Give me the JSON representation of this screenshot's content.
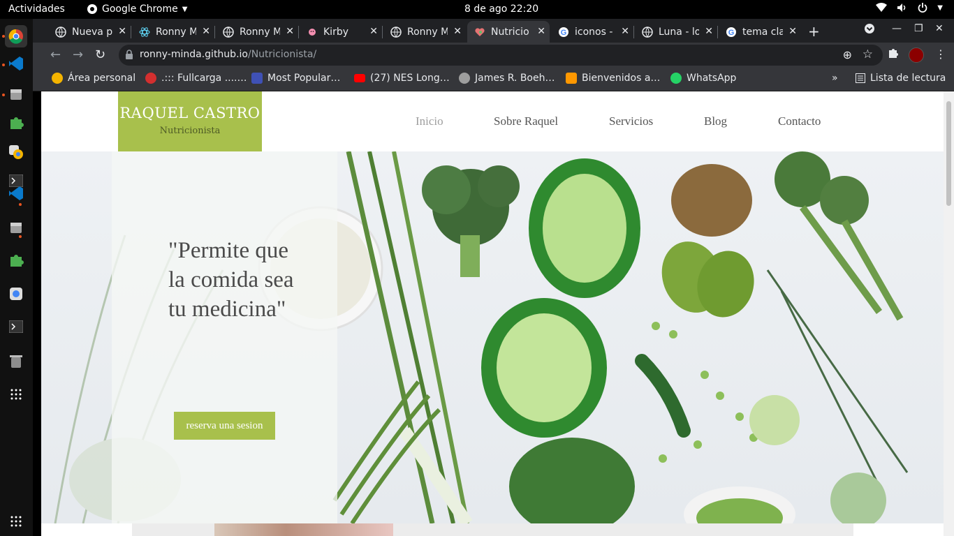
{
  "system": {
    "activities": "Actividades",
    "app_name": "Google Chrome",
    "clock": "8 de ago  22:20"
  },
  "tabs": [
    {
      "title": "Nueva p",
      "icon": "globe-icon"
    },
    {
      "title": "Ronny M",
      "icon": "react-icon"
    },
    {
      "title": "Ronny M",
      "icon": "globe-icon"
    },
    {
      "title": "Kirby",
      "icon": "kirby-icon"
    },
    {
      "title": "Ronny M",
      "icon": "globe-icon"
    },
    {
      "title": "Nutricio",
      "icon": "heart-icon",
      "active": true
    },
    {
      "title": "iconos -",
      "icon": "google-icon"
    },
    {
      "title": "Luna - lo",
      "icon": "globe-icon"
    },
    {
      "title": "tema cla",
      "icon": "google-icon"
    }
  ],
  "address_bar": {
    "domain": "ronny-minda.github.io",
    "path": "/Nutricionista/"
  },
  "bookmarks": [
    {
      "label": "Área personal",
      "color": "#f4b400"
    },
    {
      "label": ".::: Fullcarga ....…",
      "color": "#d32f2f"
    },
    {
      "label": "Most Popular…",
      "color": "#3f51b5"
    },
    {
      "label": "(27) NES Long…",
      "color": "#ff0000"
    },
    {
      "label": "James R. Boeh…",
      "color": "#9e9e9e"
    },
    {
      "label": "Bienvenidos a…",
      "color": "#ff9800"
    },
    {
      "label": "WhatsApp",
      "color": "#25d366"
    }
  ],
  "reading_list": "Lista de lectura",
  "site": {
    "logo_name": "RAQUEL CASTRO",
    "logo_role": "Nutricionista",
    "nav": [
      "Inicio",
      "Sobre Raquel",
      "Servicios",
      "Blog",
      "Contacto"
    ],
    "quote": "\"Permite que la comida sea tu medicina\"",
    "cta": "reserva una sesion",
    "accent": "#a8c04c"
  }
}
